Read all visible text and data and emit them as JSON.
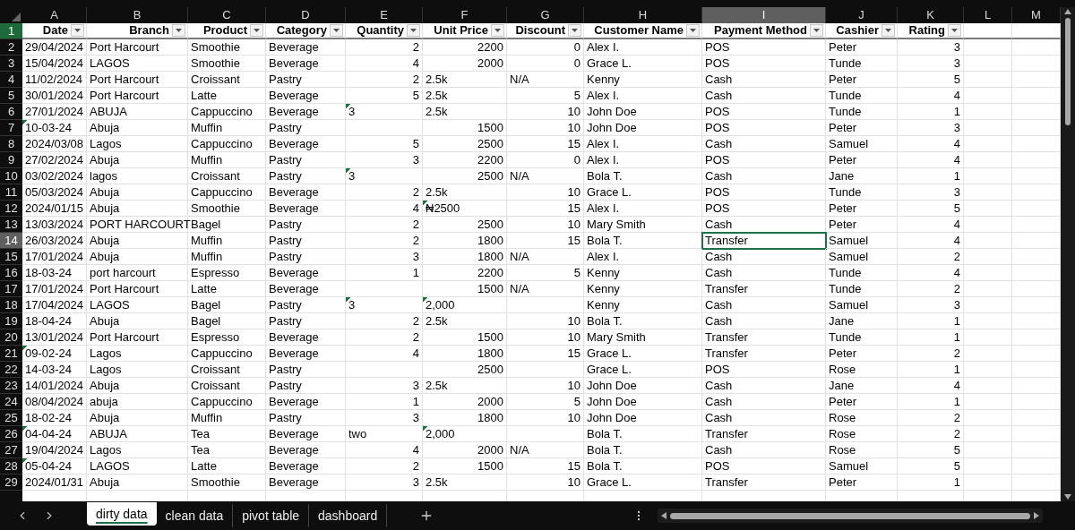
{
  "columns": [
    {
      "letter": "A",
      "selected": false
    },
    {
      "letter": "B",
      "selected": false
    },
    {
      "letter": "C",
      "selected": false
    },
    {
      "letter": "D",
      "selected": false
    },
    {
      "letter": "E",
      "selected": false
    },
    {
      "letter": "F",
      "selected": false
    },
    {
      "letter": "G",
      "selected": false
    },
    {
      "letter": "H",
      "selected": false
    },
    {
      "letter": "I",
      "selected": true
    },
    {
      "letter": "J",
      "selected": false
    },
    {
      "letter": "K",
      "selected": false
    },
    {
      "letter": "L",
      "selected": false
    },
    {
      "letter": "M",
      "selected": false
    }
  ],
  "header_row": {
    "number": "1",
    "labels": [
      "Date",
      "Branch",
      "Product",
      "Category",
      "Quantity",
      "Unit Price",
      "Discount",
      "Customer Name",
      "Payment Method",
      "Cashier",
      "Rating"
    ]
  },
  "rows": [
    {
      "number": "2",
      "selected": false,
      "cells": [
        "29/04/2024",
        "Port Harcourt",
        "Smoothie",
        "Beverage",
        "2",
        "2200",
        "0",
        "Alex I.",
        "POS",
        "Peter",
        "3"
      ],
      "warnings": [
        false,
        false,
        false,
        false,
        false,
        false,
        false,
        false,
        false,
        false,
        false
      ]
    },
    {
      "number": "3",
      "selected": false,
      "cells": [
        "15/04/2024",
        "LAGOS",
        "Smoothie",
        "Beverage",
        "4",
        "2000",
        "0",
        "Grace L.",
        "POS",
        "Tunde",
        "3"
      ],
      "warnings": [
        false,
        false,
        false,
        false,
        false,
        false,
        false,
        false,
        false,
        false,
        false
      ]
    },
    {
      "number": "4",
      "selected": false,
      "cells": [
        "11/02/2024",
        "Port Harcourt",
        "Croissant",
        "Pastry",
        "2",
        "2.5k",
        "N/A",
        "Kenny",
        "Cash",
        "Peter",
        "5"
      ],
      "warnings": [
        false,
        false,
        false,
        false,
        false,
        false,
        false,
        false,
        false,
        false,
        false
      ]
    },
    {
      "number": "5",
      "selected": false,
      "cells": [
        "30/01/2024",
        "Port Harcourt",
        "Latte",
        "Beverage",
        "5",
        "2.5k",
        "5",
        "Alex I.",
        "Cash",
        "Tunde",
        "4"
      ],
      "warnings": [
        false,
        false,
        false,
        false,
        false,
        false,
        false,
        false,
        false,
        false,
        false
      ]
    },
    {
      "number": "6",
      "selected": false,
      "cells": [
        "27/01/2024",
        "ABUJA",
        "Cappuccino",
        "Beverage",
        "3",
        "2.5k",
        "10",
        "John Doe",
        "POS",
        "Tunde",
        "1"
      ],
      "warnings": [
        false,
        false,
        false,
        false,
        true,
        false,
        false,
        false,
        false,
        false,
        false
      ]
    },
    {
      "number": "7",
      "selected": false,
      "cells": [
        "10-03-24",
        "Abuja",
        "Muffin",
        "Pastry",
        null,
        "1500",
        "10",
        "John Doe",
        "POS",
        "Peter",
        "3"
      ],
      "warnings": [
        true,
        false,
        false,
        false,
        false,
        false,
        false,
        false,
        false,
        false,
        false
      ]
    },
    {
      "number": "8",
      "selected": false,
      "cells": [
        "2024/03/08",
        "Lagos",
        "Cappuccino",
        "Beverage",
        "5",
        "2500",
        "15",
        "Alex I.",
        "Cash",
        "Samuel",
        "4"
      ],
      "warnings": [
        false,
        false,
        false,
        false,
        false,
        false,
        false,
        false,
        false,
        false,
        false
      ]
    },
    {
      "number": "9",
      "selected": false,
      "cells": [
        "27/02/2024",
        "Abuja",
        "Muffin",
        "Pastry",
        "3",
        "2200",
        "0",
        "Alex I.",
        "POS",
        "Peter",
        "4"
      ],
      "warnings": [
        false,
        false,
        false,
        false,
        false,
        false,
        false,
        false,
        false,
        false,
        false
      ]
    },
    {
      "number": "10",
      "selected": false,
      "cells": [
        "03/02/2024",
        "lagos",
        "Croissant",
        "Pastry",
        "3",
        "2500",
        "N/A",
        "Bola T.",
        "Cash",
        "Jane",
        "1"
      ],
      "warnings": [
        false,
        false,
        false,
        false,
        true,
        false,
        false,
        false,
        false,
        false,
        false
      ]
    },
    {
      "number": "11",
      "selected": false,
      "cells": [
        "05/03/2024",
        "Abuja",
        "Cappuccino",
        "Beverage",
        "2",
        "2.5k",
        "10",
        "Grace L.",
        "POS",
        "Tunde",
        "3"
      ],
      "warnings": [
        false,
        false,
        false,
        false,
        false,
        false,
        false,
        false,
        false,
        false,
        false
      ]
    },
    {
      "number": "12",
      "selected": false,
      "cells": [
        "2024/01/15",
        "Abuja",
        "Smoothie",
        "Beverage",
        "4",
        "₦2500",
        "15",
        "Alex I.",
        "POS",
        "Peter",
        "5"
      ],
      "warnings": [
        false,
        false,
        false,
        false,
        false,
        true,
        false,
        false,
        false,
        false,
        false
      ]
    },
    {
      "number": "13",
      "selected": false,
      "cells": [
        "13/03/2024",
        "PORT HARCOURT",
        "Bagel",
        "Pastry",
        "2",
        "2500",
        "10",
        "Mary Smith",
        "Cash",
        "Peter",
        "4"
      ],
      "warnings": [
        false,
        false,
        false,
        false,
        false,
        false,
        false,
        false,
        false,
        false,
        false
      ]
    },
    {
      "number": "14",
      "selected": true,
      "cells": [
        "26/03/2024",
        "Abuja",
        "Muffin",
        "Pastry",
        "2",
        "1800",
        "15",
        "Bola T.",
        "Transfer",
        "Samuel",
        "4"
      ],
      "warnings": [
        false,
        false,
        false,
        false,
        false,
        false,
        false,
        false,
        false,
        false,
        false
      ]
    },
    {
      "number": "15",
      "selected": false,
      "cells": [
        "17/01/2024",
        "Abuja",
        "Muffin",
        "Pastry",
        "3",
        "1800",
        "N/A",
        "Alex I.",
        "Cash",
        "Samuel",
        "2"
      ],
      "warnings": [
        false,
        false,
        false,
        false,
        false,
        false,
        false,
        false,
        false,
        false,
        false
      ]
    },
    {
      "number": "16",
      "selected": false,
      "cells": [
        "18-03-24",
        "port harcourt",
        "Espresso",
        "Beverage",
        "1",
        "2200",
        "5",
        "Kenny",
        "Cash",
        "Tunde",
        "4"
      ],
      "warnings": [
        false,
        false,
        false,
        false,
        false,
        false,
        false,
        false,
        false,
        false,
        false
      ]
    },
    {
      "number": "17",
      "selected": false,
      "cells": [
        "17/01/2024",
        "Port Harcourt",
        "Latte",
        "Beverage",
        null,
        "1500",
        "N/A",
        "Kenny",
        "Transfer",
        "Tunde",
        "2"
      ],
      "warnings": [
        false,
        false,
        false,
        false,
        false,
        false,
        false,
        false,
        false,
        false,
        false
      ]
    },
    {
      "number": "18",
      "selected": false,
      "cells": [
        "17/04/2024",
        "LAGOS",
        "Bagel",
        "Pastry",
        "3",
        "2,000",
        null,
        "Kenny",
        "Cash",
        "Samuel",
        "3"
      ],
      "warnings": [
        false,
        false,
        false,
        false,
        true,
        true,
        false,
        false,
        false,
        false,
        false
      ]
    },
    {
      "number": "19",
      "selected": false,
      "cells": [
        "18-04-24",
        "Abuja",
        "Bagel",
        "Pastry",
        "2",
        "2.5k",
        "10",
        "Bola T.",
        "Cash",
        "Jane",
        "1"
      ],
      "warnings": [
        false,
        false,
        false,
        false,
        false,
        false,
        false,
        false,
        false,
        false,
        false
      ]
    },
    {
      "number": "20",
      "selected": false,
      "cells": [
        "13/01/2024",
        "Port Harcourt",
        "Espresso",
        "Beverage",
        "2",
        "1500",
        "10",
        "Mary Smith",
        "Transfer",
        "Tunde",
        "1"
      ],
      "warnings": [
        false,
        false,
        false,
        false,
        false,
        false,
        false,
        false,
        false,
        false,
        false
      ]
    },
    {
      "number": "21",
      "selected": false,
      "cells": [
        "09-02-24",
        "Lagos",
        "Cappuccino",
        "Beverage",
        "4",
        "1800",
        "15",
        "Grace L.",
        "Transfer",
        "Peter",
        "2"
      ],
      "warnings": [
        true,
        false,
        false,
        false,
        false,
        false,
        false,
        false,
        false,
        false,
        false
      ]
    },
    {
      "number": "22",
      "selected": false,
      "cells": [
        "14-03-24",
        "Lagos",
        "Croissant",
        "Pastry",
        null,
        "2500",
        null,
        "Grace L.",
        "POS",
        "Rose",
        "1"
      ],
      "warnings": [
        false,
        false,
        false,
        false,
        false,
        false,
        false,
        false,
        false,
        false,
        false
      ]
    },
    {
      "number": "23",
      "selected": false,
      "cells": [
        "14/01/2024",
        "Abuja",
        "Croissant",
        "Pastry",
        "3",
        "2.5k",
        "10",
        "John Doe",
        "Cash",
        "Jane",
        "4"
      ],
      "warnings": [
        false,
        false,
        false,
        false,
        false,
        false,
        false,
        false,
        false,
        false,
        false
      ]
    },
    {
      "number": "24",
      "selected": false,
      "cells": [
        "08/04/2024",
        "abuja",
        "Cappuccino",
        "Beverage",
        "1",
        "2000",
        "5",
        "John Doe",
        "Cash",
        "Peter",
        "1"
      ],
      "warnings": [
        false,
        false,
        false,
        false,
        false,
        false,
        false,
        false,
        false,
        false,
        false
      ]
    },
    {
      "number": "25",
      "selected": false,
      "cells": [
        "18-02-24",
        "Abuja",
        "Muffin",
        "Pastry",
        "3",
        "1800",
        "10",
        "John Doe",
        "Cash",
        "Rose",
        "2"
      ],
      "warnings": [
        false,
        false,
        false,
        false,
        false,
        false,
        false,
        false,
        false,
        false,
        false
      ]
    },
    {
      "number": "26",
      "selected": false,
      "cells": [
        "04-04-24",
        "ABUJA",
        "Tea",
        "Beverage",
        "two",
        "2,000",
        null,
        "Bola T.",
        "Transfer",
        "Rose",
        "2"
      ],
      "warnings": [
        true,
        false,
        false,
        false,
        false,
        true,
        false,
        false,
        false,
        false,
        false
      ]
    },
    {
      "number": "27",
      "selected": false,
      "cells": [
        "19/04/2024",
        "Lagos",
        "Tea",
        "Beverage",
        "4",
        "2000",
        "N/A",
        "Bola T.",
        "Cash",
        "Rose",
        "5"
      ],
      "warnings": [
        false,
        false,
        false,
        false,
        false,
        false,
        false,
        false,
        false,
        false,
        false
      ]
    },
    {
      "number": "28",
      "selected": false,
      "cells": [
        "05-04-24",
        "LAGOS",
        "Latte",
        "Beverage",
        "2",
        "1500",
        "15",
        "Bola T.",
        "POS",
        "Samuel",
        "5"
      ],
      "warnings": [
        true,
        false,
        false,
        false,
        false,
        false,
        false,
        false,
        false,
        false,
        false
      ]
    },
    {
      "number": "29",
      "selected": false,
      "cells": [
        "2024/01/31",
        "Abuja",
        "Smoothie",
        "Beverage",
        "3",
        "2.5k",
        "10",
        "Grace L.",
        "Transfer",
        "Peter",
        "1"
      ],
      "warnings": [
        false,
        false,
        false,
        false,
        false,
        false,
        false,
        false,
        false,
        false,
        false
      ]
    }
  ],
  "sheet_tabs": [
    {
      "label": "dirty data",
      "selected": true
    },
    {
      "label": "clean data",
      "selected": false
    },
    {
      "label": "pivot table",
      "selected": false
    },
    {
      "label": "dashboard",
      "selected": false
    }
  ]
}
